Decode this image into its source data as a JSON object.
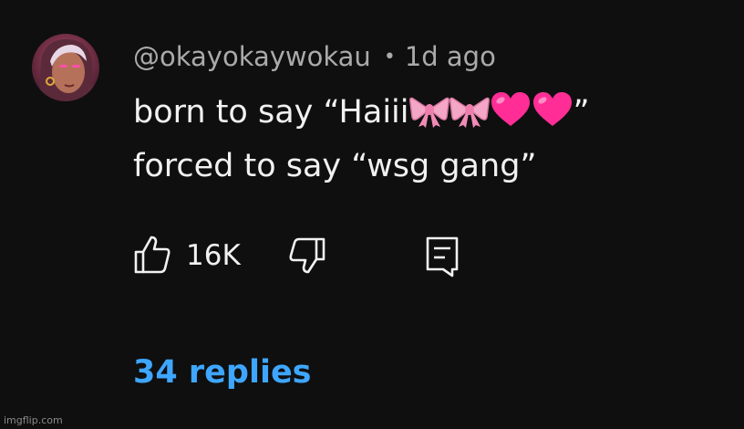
{
  "comment": {
    "author": "@okayokaywokau",
    "separator": "•",
    "timestamp": "1d ago",
    "line1_prefix": "born to say “Haiii",
    "line1_emojis": [
      "ribbon",
      "ribbon",
      "pink-heart",
      "pink-heart"
    ],
    "line1_suffix": "”",
    "line2": "forced to say “wsg gang”",
    "likes": "16K",
    "replies_label": "34 replies",
    "icons": {
      "like": "thumbs-up-icon",
      "dislike": "thumbs-down-icon",
      "reply": "reply-comment-icon"
    }
  },
  "colors": {
    "background": "#0f0f0f",
    "text": "#f1f1f1",
    "muted": "#aaaaaa",
    "link": "#3ea6ff",
    "ribbon": "#f4a6c6",
    "heart": "#ff2d95"
  },
  "watermark": "imgflip.com"
}
